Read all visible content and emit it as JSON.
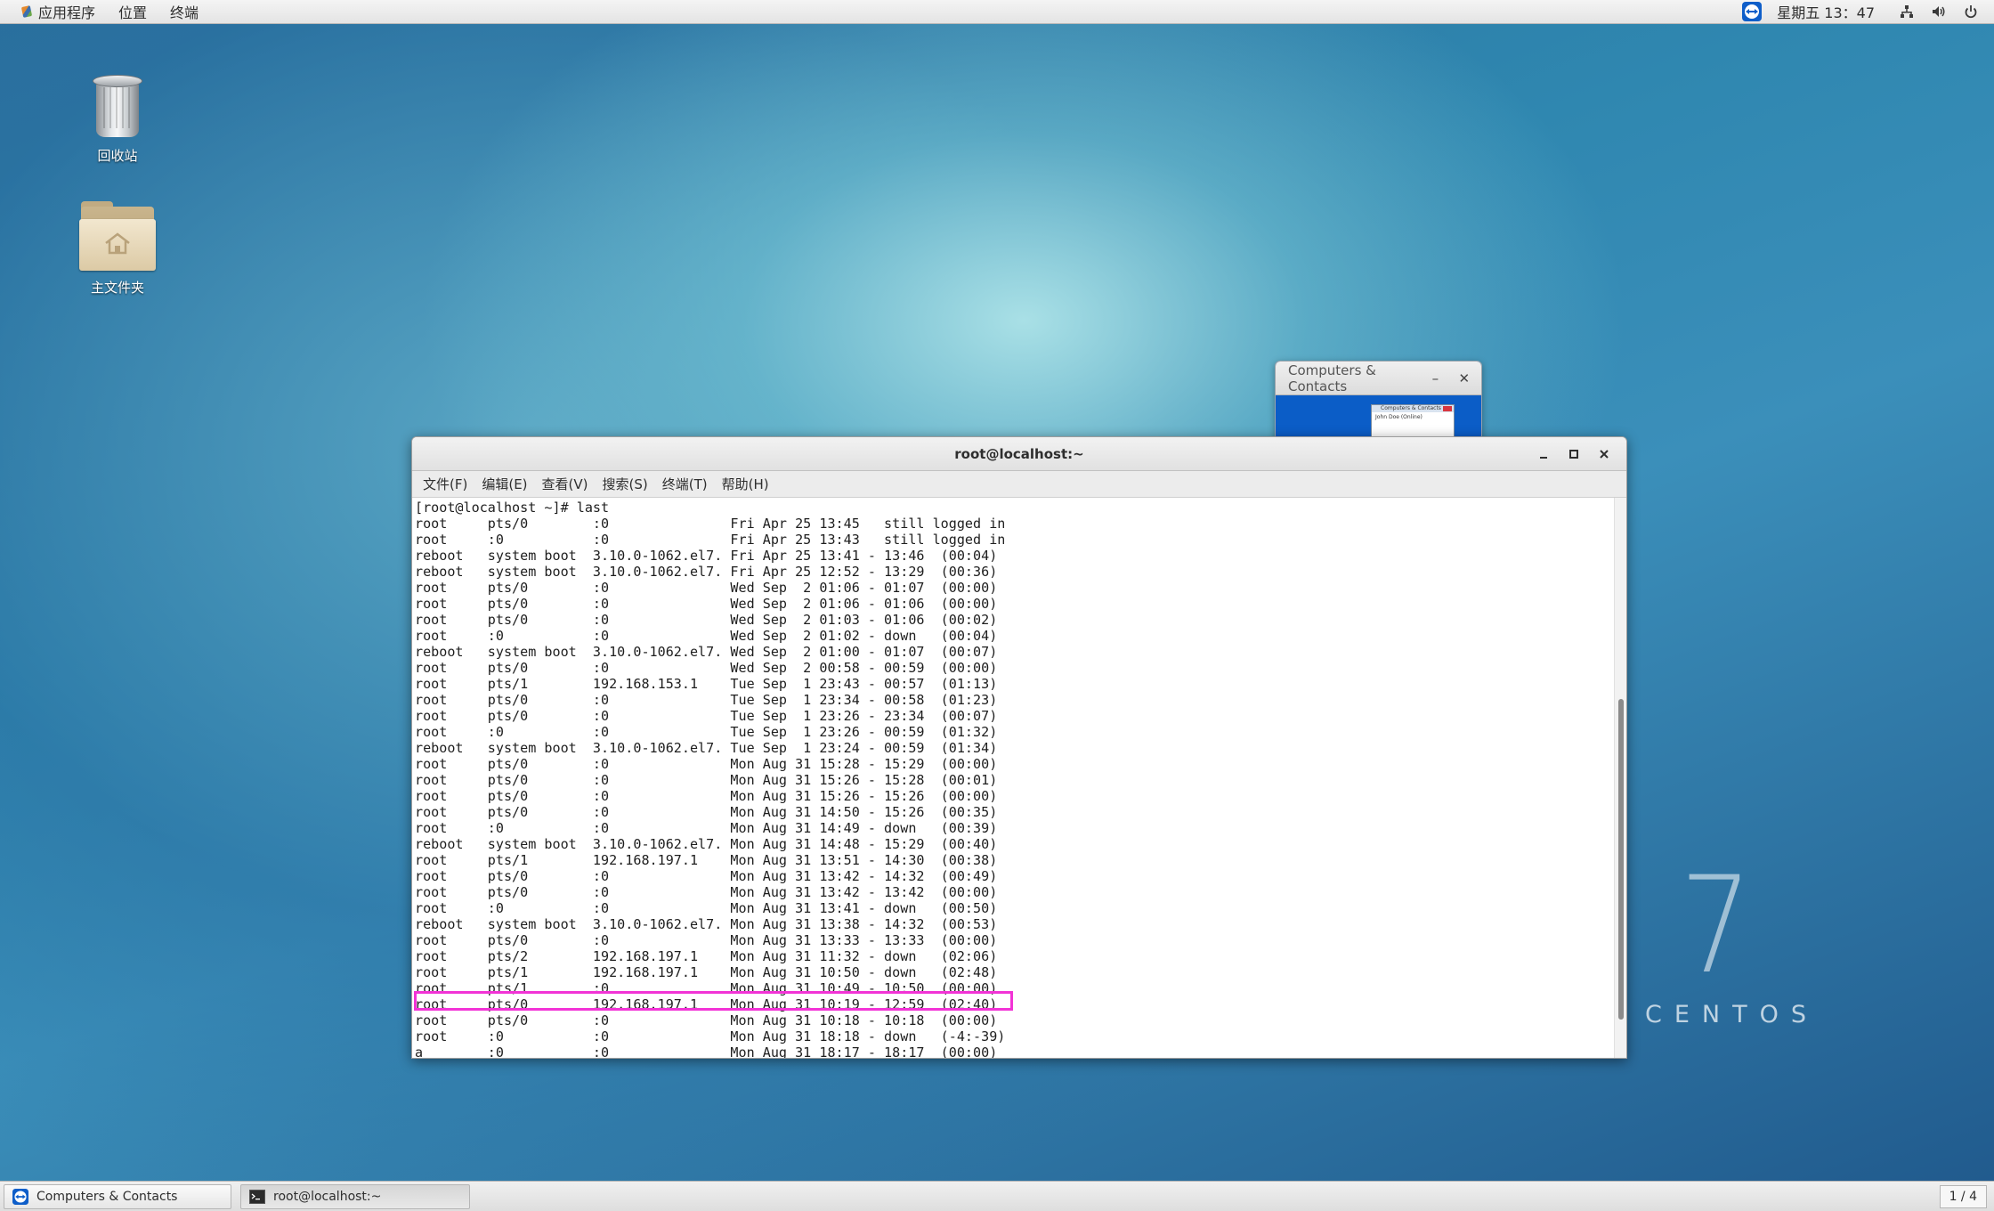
{
  "top_panel": {
    "menu": [
      "应用程序",
      "位置",
      "终端"
    ],
    "clock": "星期五 13：47",
    "icons": [
      "teamviewer-icon",
      "network-icon",
      "volume-icon",
      "power-icon"
    ]
  },
  "desktop": {
    "icons": [
      {
        "label": "回收站",
        "icon": "trash-icon"
      },
      {
        "label": "主文件夹",
        "icon": "home-folder-icon"
      }
    ]
  },
  "cc_window": {
    "title": "Computers & Contacts",
    "minimize": "–",
    "close": "✕",
    "thumb_title": "Computers & Contacts",
    "thumb_user": "John Doe (Online)"
  },
  "terminal": {
    "title": "root@localhost:~",
    "menu": [
      "文件(F)",
      "编辑(E)",
      "查看(V)",
      "搜索(S)",
      "终端(T)",
      "帮助(H)"
    ],
    "lines": [
      "[root@localhost ~]# last",
      "root     pts/0        :0               Fri Apr 25 13:45   still logged in",
      "root     :0           :0               Fri Apr 25 13:43   still logged in",
      "reboot   system boot  3.10.0-1062.el7. Fri Apr 25 13:41 - 13:46  (00:04)",
      "reboot   system boot  3.10.0-1062.el7. Fri Apr 25 12:52 - 13:29  (00:36)",
      "root     pts/0        :0               Wed Sep  2 01:06 - 01:07  (00:00)",
      "root     pts/0        :0               Wed Sep  2 01:06 - 01:06  (00:00)",
      "root     pts/0        :0               Wed Sep  2 01:03 - 01:06  (00:02)",
      "root     :0           :0               Wed Sep  2 01:02 - down   (00:04)",
      "reboot   system boot  3.10.0-1062.el7. Wed Sep  2 01:00 - 01:07  (00:07)",
      "root     pts/0        :0               Wed Sep  2 00:58 - 00:59  (00:00)",
      "root     pts/1        192.168.153.1    Tue Sep  1 23:43 - 00:57  (01:13)",
      "root     pts/0        :0               Tue Sep  1 23:34 - 00:58  (01:23)",
      "root     pts/0        :0               Tue Sep  1 23:26 - 23:34  (00:07)",
      "root     :0           :0               Tue Sep  1 23:26 - 00:59  (01:32)",
      "reboot   system boot  3.10.0-1062.el7. Tue Sep  1 23:24 - 00:59  (01:34)",
      "root     pts/0        :0               Mon Aug 31 15:28 - 15:29  (00:00)",
      "root     pts/0        :0               Mon Aug 31 15:26 - 15:28  (00:01)",
      "root     pts/0        :0               Mon Aug 31 15:26 - 15:26  (00:00)",
      "root     pts/0        :0               Mon Aug 31 14:50 - 15:26  (00:35)",
      "root     :0           :0               Mon Aug 31 14:49 - down   (00:39)",
      "reboot   system boot  3.10.0-1062.el7. Mon Aug 31 14:48 - 15:29  (00:40)",
      "root     pts/1        192.168.197.1    Mon Aug 31 13:51 - 14:30  (00:38)",
      "root     pts/0        :0               Mon Aug 31 13:42 - 14:32  (00:49)",
      "root     pts/0        :0               Mon Aug 31 13:42 - 13:42  (00:00)",
      "root     :0           :0               Mon Aug 31 13:41 - down   (00:50)",
      "reboot   system boot  3.10.0-1062.el7. Mon Aug 31 13:38 - 14:32  (00:53)",
      "root     pts/0        :0               Mon Aug 31 13:33 - 13:33  (00:00)",
      "root     pts/2        192.168.197.1    Mon Aug 31 11:32 - down   (02:06)",
      "root     pts/1        192.168.197.1    Mon Aug 31 10:50 - down   (02:48)",
      "root     pts/1        :0               Mon Aug 31 10:49 - 10:50  (00:00)",
      "root     pts/0        192.168.197.1    Mon Aug 31 10:19 - 12:59  (02:40)",
      "root     pts/0        :0               Mon Aug 31 10:18 - 10:18  (00:00)",
      "root     :0           :0               Mon Aug 31 18:18 - down   (-4:-39)",
      "a        :0           :0               Mon Aug 31 18:17 - 18:17  (00:00)"
    ]
  },
  "centos": {
    "version": "7",
    "name": "CENTOS"
  },
  "taskbar": {
    "tasks": [
      "Computers & Contacts",
      "root@localhost:~"
    ],
    "pager": "1 / 4"
  },
  "colors": {
    "highlight": "#f233d6",
    "teamviewer_blue": "#0e5ec9"
  }
}
